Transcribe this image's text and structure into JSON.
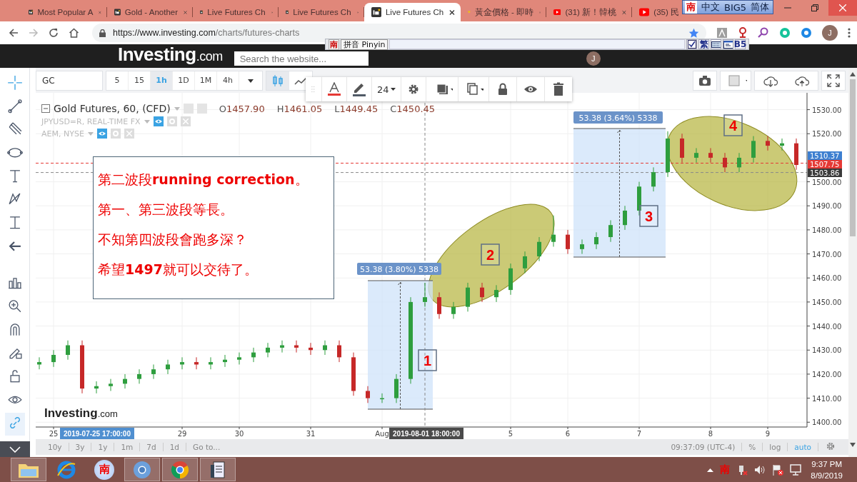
{
  "browser": {
    "tabs": [
      {
        "title": "Most Popular A",
        "kind": "site",
        "selected": false
      },
      {
        "title": "Gold - Another",
        "kind": "site",
        "selected": false
      },
      {
        "title": "Live Futures Ch",
        "kind": "site",
        "selected": false
      },
      {
        "title": "Live Futures Ch",
        "kind": "site",
        "selected": false
      },
      {
        "title": "Live Futures Ch",
        "kind": "site",
        "selected": true
      },
      {
        "title": "黃金價格 - 即時",
        "kind": "gem",
        "selected": false
      },
      {
        "title": "(31) 新！韓桃",
        "kind": "video",
        "selected": false
      },
      {
        "title": "(35) 民",
        "kind": "video",
        "selected": false
      }
    ],
    "url_host": "https://www.investing.com",
    "url_path": "/charts/futures-charts",
    "profile_initial": "J"
  },
  "ime_bar": {
    "logo": "南",
    "mode": "中文",
    "encoding": "BIG5",
    "script": "简体"
  },
  "site_header": {
    "logo_main": "Investing",
    "logo_suffix": ".com",
    "search_placeholder": "Search the website...",
    "user_initial": "J"
  },
  "pinyin_ime": {
    "logo": "南",
    "label": "拼音 Pinyin",
    "traditional": "繁",
    "big5": "B5"
  },
  "chart_toolbar": {
    "symbol": "GC",
    "intervals": [
      {
        "label": "5",
        "selected": false
      },
      {
        "label": "15",
        "selected": false
      },
      {
        "label": "1h",
        "selected": true
      },
      {
        "label": "1D",
        "selected": false
      },
      {
        "label": "1M",
        "selected": false
      },
      {
        "label": "4h",
        "selected": false
      }
    ]
  },
  "drawing_toolbar": {
    "font_size": "24"
  },
  "legend": {
    "title": "Gold Futures, 60, (CFD)",
    "ohlc": [
      {
        "key": "O",
        "value": "1457.90"
      },
      {
        "key": "H",
        "value": "1461.05"
      },
      {
        "key": "L",
        "value": "1449.45"
      },
      {
        "key": "C",
        "value": "1450.45"
      }
    ],
    "overlays": [
      "JPYUSD=R, REAL-TIME FX",
      "AEM, NYSE"
    ]
  },
  "chart": {
    "note": [
      "第二波段**running correction**。",
      "第一、第三波段等長。",
      "不知第四波段會跑多深？",
      "希望**1497**就可以交待了。"
    ],
    "measurements": [
      "53.38 (3.80%) 5338",
      "53.38 (3.64%) 5338"
    ],
    "wave_labels": [
      "1",
      "2",
      "3",
      "4"
    ],
    "price_labels": [
      {
        "text": "1510.37",
        "color": "#3d7fd0"
      },
      {
        "text": "1507.75",
        "color": "#e53935"
      },
      {
        "text": "1503.86",
        "color": "#3a3a3a"
      }
    ],
    "crosshair_dates": [
      {
        "text": "2019-07-25 17:00:00",
        "color": "#4f8fd0"
      },
      {
        "text": "2019-08-01 18:00:00",
        "color": "#4a4a4a"
      }
    ],
    "logo_main": "Investing",
    "logo_suffix": ".com",
    "chart_data": {
      "type": "candlestick",
      "ylim": [
        1398,
        1537
      ],
      "grid": true,
      "yticks": [
        {
          "value": 1530,
          "label": "1530.00"
        },
        {
          "value": 1520,
          "label": "1520.00"
        },
        {
          "value": 1500,
          "label": "1500.00"
        },
        {
          "value": 1490,
          "label": "1490.00"
        },
        {
          "value": 1480,
          "label": "1480.00"
        },
        {
          "value": 1470,
          "label": "1470.00"
        },
        {
          "value": 1460,
          "label": "1460.00"
        },
        {
          "value": 1450,
          "label": "1450.00"
        },
        {
          "value": 1440,
          "label": "1440.00"
        },
        {
          "value": 1430,
          "label": "1430.00"
        },
        {
          "value": 1420,
          "label": "1420.00"
        },
        {
          "value": 1410,
          "label": "1410.00"
        },
        {
          "value": 1400,
          "label": "1400.00"
        }
      ],
      "categories": [
        null,
        "25",
        null,
        null,
        null,
        null,
        null,
        null,
        null,
        null,
        "29",
        null,
        null,
        null,
        "30",
        null,
        null,
        null,
        null,
        "31",
        null,
        null,
        null,
        null,
        "Aug",
        null,
        null,
        null,
        null,
        null,
        null,
        null,
        null,
        "5",
        null,
        null,
        null,
        "6",
        null,
        null,
        null,
        null,
        "7",
        null,
        null,
        null,
        null,
        "8",
        null,
        null,
        null,
        "9",
        null,
        null
      ],
      "ref_lines": [
        {
          "axis": "y",
          "value": 1507.75,
          "color": "#e53935"
        },
        {
          "axis": "y",
          "value": 1503.86,
          "color": "#888888"
        }
      ],
      "ohlc": [
        [
          1424,
          1427,
          1422,
          1425
        ],
        [
          1425,
          1430,
          1423,
          1428
        ],
        [
          1428,
          1434,
          1426,
          1432
        ],
        [
          1432,
          1434,
          1412,
          1414
        ],
        [
          1414,
          1417,
          1412,
          1415
        ],
        [
          1415,
          1418,
          1413,
          1416
        ],
        [
          1416,
          1420,
          1414,
          1418
        ],
        [
          1418,
          1422,
          1416,
          1420
        ],
        [
          1420,
          1424,
          1418,
          1422
        ],
        [
          1422,
          1426,
          1420,
          1424
        ],
        [
          1424,
          1427,
          1422,
          1425
        ],
        [
          1425,
          1427,
          1422,
          1424
        ],
        [
          1424,
          1427,
          1422,
          1425
        ],
        [
          1425,
          1428,
          1423,
          1426
        ],
        [
          1426,
          1429,
          1424,
          1427
        ],
        [
          1427,
          1431,
          1425,
          1429
        ],
        [
          1429,
          1433,
          1427,
          1431
        ],
        [
          1431,
          1434,
          1429,
          1432
        ],
        [
          1432,
          1434,
          1429,
          1431
        ],
        [
          1431,
          1433,
          1428,
          1430
        ],
        [
          1430,
          1434,
          1428,
          1432
        ],
        [
          1432,
          1434,
          1425,
          1427
        ],
        [
          1427,
          1429,
          1411,
          1413
        ],
        [
          1413,
          1415,
          1408,
          1410
        ],
        [
          1410,
          1412,
          1408,
          1410
        ],
        [
          1410,
          1420,
          1408,
          1418
        ],
        [
          1418,
          1452,
          1416,
          1450
        ],
        [
          1450,
          1458,
          1448,
          1452
        ],
        [
          1452,
          1454,
          1443,
          1445
        ],
        [
          1445,
          1450,
          1443,
          1448
        ],
        [
          1448,
          1458,
          1446,
          1456
        ],
        [
          1456,
          1458,
          1450,
          1452
        ],
        [
          1452,
          1457,
          1450,
          1455
        ],
        [
          1455,
          1466,
          1453,
          1464
        ],
        [
          1464,
          1471,
          1462,
          1469
        ],
        [
          1469,
          1477,
          1467,
          1475
        ],
        [
          1475,
          1486,
          1473,
          1478
        ],
        [
          1478,
          1480,
          1470,
          1472
        ],
        [
          1472,
          1476,
          1470,
          1474
        ],
        [
          1474,
          1479,
          1472,
          1477
        ],
        [
          1477,
          1484,
          1475,
          1482
        ],
        [
          1482,
          1490,
          1480,
          1488
        ],
        [
          1488,
          1500,
          1486,
          1498
        ],
        [
          1498,
          1506,
          1496,
          1504
        ],
        [
          1504,
          1521,
          1502,
          1518
        ],
        [
          1518,
          1520,
          1508,
          1510
        ],
        [
          1510,
          1514,
          1508,
          1512
        ],
        [
          1512,
          1514,
          1508,
          1510
        ],
        [
          1510,
          1512,
          1504,
          1506
        ],
        [
          1506,
          1512,
          1504,
          1510
        ],
        [
          1510,
          1519,
          1508,
          1517
        ],
        [
          1517,
          1519,
          1513,
          1515
        ],
        [
          1515,
          1518,
          1513,
          1516
        ],
        [
          1516,
          1518,
          1505,
          1507
        ]
      ]
    }
  },
  "bottom_bar": {
    "ranges": [
      "10y",
      "3y",
      "1y",
      "1m",
      "7d",
      "1d"
    ],
    "goto": "Go to...",
    "clock": "09:37:09 (UTC-4)",
    "scale_options": [
      {
        "label": "%",
        "selected": false
      },
      {
        "label": "log",
        "selected": false
      },
      {
        "label": "auto",
        "selected": true
      }
    ]
  },
  "taskbar": {
    "ime_app": "南",
    "tray_ime": "南",
    "time": "9:37 PM",
    "date": "8/9/2019"
  }
}
